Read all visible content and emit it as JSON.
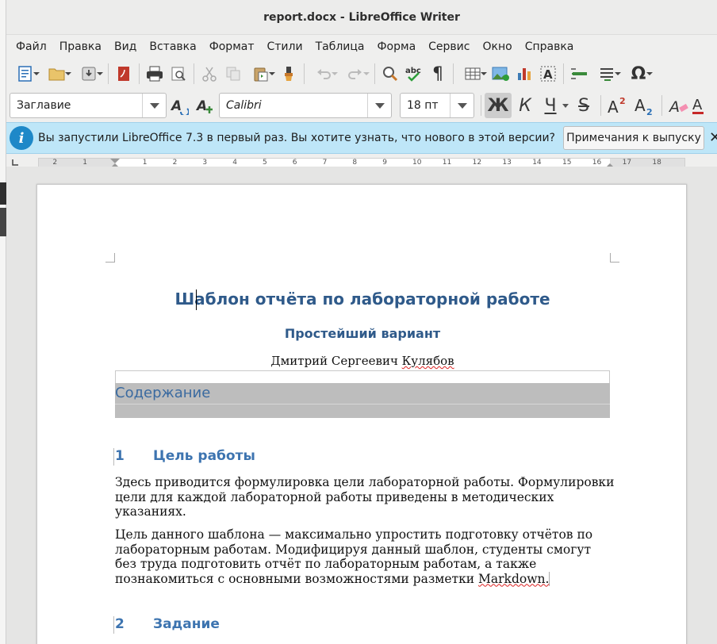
{
  "window": {
    "title": "report.docx - LibreOffice Writer"
  },
  "menu": [
    "Файл",
    "Правка",
    "Вид",
    "Вставка",
    "Формат",
    "Стили",
    "Таблица",
    "Форма",
    "Сервис",
    "Окно",
    "Справка"
  ],
  "format_bar": {
    "paragraph_style": "Заглавие",
    "font_name": "Calibri",
    "font_size": "18 пт",
    "bold_label": "Ж",
    "italic_label": "К",
    "underline_label": "Ч",
    "strike_label": "S"
  },
  "infobar": {
    "message": "Вы запустили LibreOffice 7.3 в первый раз. Вы хотите узнать, что нового в этой версии?",
    "button": "Примечания к выпуску",
    "close": "✕"
  },
  "ruler": {
    "labels": [
      "2",
      "1",
      "1",
      "2",
      "3",
      "4",
      "5",
      "6",
      "7",
      "8",
      "9",
      "10",
      "11",
      "12",
      "13",
      "14",
      "15",
      "16",
      "17",
      "18"
    ]
  },
  "document": {
    "title": "Шаблон отчёта по лабораторной работе",
    "subtitle": "Простейший вариант",
    "author_first": "Дмитрий Сергеевич ",
    "author_last": "Кулябов",
    "toc_heading": "Содержание",
    "sections": [
      {
        "number": "1",
        "title": "Цель работы"
      },
      {
        "number": "2",
        "title": "Задание"
      }
    ],
    "paragraph1": "Здесь приводится формулировка цели лабораторной работы. Формулировки цели для каждой лабораторной работы приведены в методических указаниях.",
    "paragraph2_text": "Цель данного шаблона — максимально упростить подготовку отчётов по лабораторным работам. Модифицируя данный шаблон, студенты смогут без труда подготовить отчёт по лабораторным работам, а также познакомиться с основными возможностями разметки  ",
    "paragraph2_link": "Markdown."
  },
  "colors": {
    "heading": "#2f5a8a",
    "section": "#3d74b0",
    "infobar": "#bee6f8",
    "info_icon": "#1e88c8"
  },
  "icons": [
    "new-document-icon",
    "open-icon",
    "save-icon",
    "export-pdf-icon",
    "print-icon",
    "print-preview-icon",
    "cut-icon",
    "copy-icon",
    "paste-icon",
    "clone-formatting-icon",
    "undo-icon",
    "redo-icon",
    "find-replace-icon",
    "spellcheck-icon",
    "formatting-marks-icon",
    "insert-table-icon",
    "insert-image-icon",
    "insert-chart-icon",
    "insert-textbox-icon",
    "insert-field-icon",
    "insert-list-icon",
    "special-character-icon"
  ]
}
